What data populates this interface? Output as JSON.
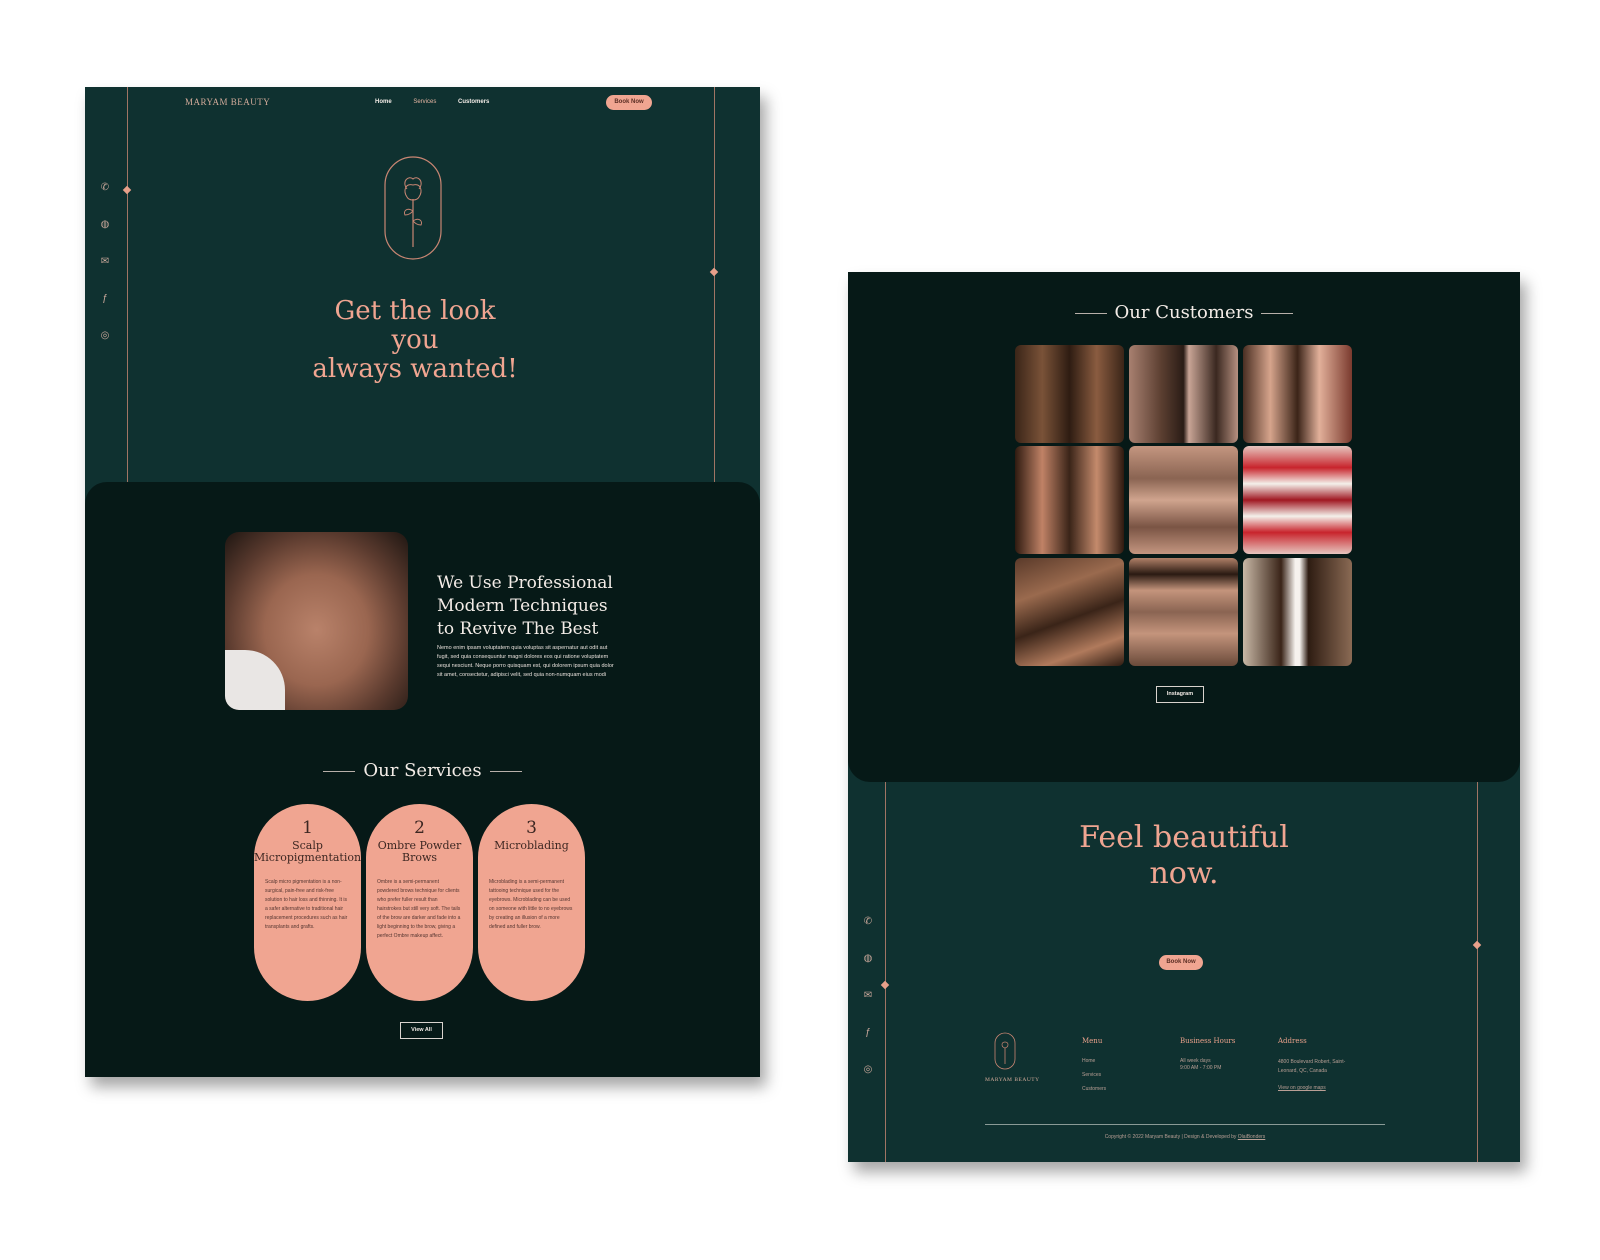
{
  "colors": {
    "green": "#0f3130",
    "dark": "#061917",
    "peach": "#f0a591",
    "cream": "#f3ece7"
  },
  "brand": "MARYAM BEAUTY",
  "nav": {
    "home": "Home",
    "services": "Services",
    "customers": "Customers"
  },
  "book_now": "Book Now",
  "social_icons": [
    "phone-icon",
    "globe-icon",
    "mail-icon",
    "facebook-icon",
    "instagram-icon"
  ],
  "hero": {
    "line1": "Get the look",
    "line2": "you",
    "line3": "always wanted!"
  },
  "about": {
    "title1": "We Use Professional",
    "title2": "Modern Techniques",
    "title3": "to Revive The Best",
    "body": "Nemo enim ipsam voluptatem quia voluptas sit aspernatur aut odit aut fugit, sed quia consequuntur magni dolores eos qui ratione voluptatem sequi nesciunt. Neque porro quisquam est, qui dolorem ipsum quia dolor sit amet, consectetur, adipisci velit, sed quia non-numquam eius modi"
  },
  "services": {
    "heading": "Our Services",
    "items": [
      {
        "num": "1",
        "name": "Scalp Micropigmentation",
        "desc": "Scalp micro pigmentation is a non-surgical, pain-free and risk-free solution to hair loss and thinning. It is a safer alternative to traditional hair replacement procedures such as hair transplants and grafts."
      },
      {
        "num": "2",
        "name": "Ombre Powder Brows",
        "desc": "Ombre is a semi-permanent powdered brows technique for clients who prefer fuller result than hairstrokes but still very soft. The tails of the brow are darker and fade into a light beginning to the brow, giving a perfect Ombre makeup affect."
      },
      {
        "num": "3",
        "name": "Microblading",
        "desc": "Microblading is a semi-permanent tattooing technique used for the eyebrows. Microblading can be used on someone with little to no eyebrows by creating an illusion of a more defined and fuller brow."
      }
    ],
    "view_all": "View All"
  },
  "customers": {
    "heading": "Our Customers",
    "instagram": "Instagram"
  },
  "cta": {
    "line1": "Feel beautiful",
    "line2": "now.",
    "button": "Book Now"
  },
  "footer": {
    "brand": "MARYAM BEAUTY",
    "menu_title": "Menu",
    "menu": [
      "Home",
      "Services",
      "Customers"
    ],
    "hours_title": "Business Hours",
    "hours_days": "All week days",
    "hours_time": "9:00 AM - 7:00 PM",
    "address_title": "Address",
    "address1": "4800 Boulevard Robert, Saint-",
    "address2": "Leonard, QC, Canada",
    "map_link": "View on google maps",
    "copyright": "Copyright © 2022 Maryam Beauty | Design & Developed by",
    "developer": "OlaiBonders"
  }
}
